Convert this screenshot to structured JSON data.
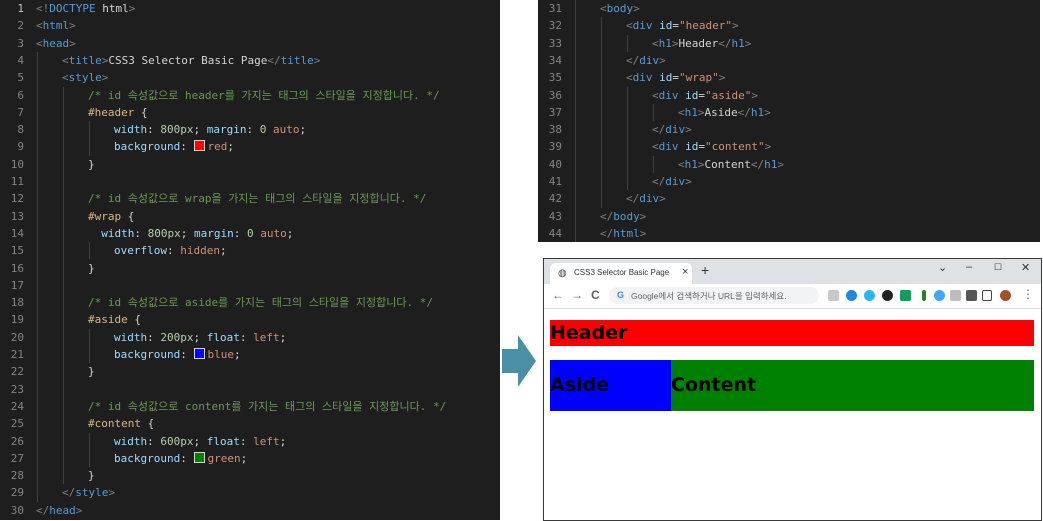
{
  "left_editor": {
    "lines": [
      {
        "n": "1",
        "indent": 0,
        "tokens": [
          [
            "punc",
            "<!"
          ],
          [
            "tag",
            "DOCTYPE"
          ],
          [
            "text",
            " html"
          ],
          [
            "punc",
            ">"
          ]
        ]
      },
      {
        "n": "2",
        "indent": 0,
        "tokens": [
          [
            "punc",
            "<"
          ],
          [
            "tag",
            "html"
          ],
          [
            "punc",
            ">"
          ]
        ]
      },
      {
        "n": "3",
        "indent": 0,
        "tokens": [
          [
            "punc",
            "<"
          ],
          [
            "tag",
            "head"
          ],
          [
            "punc",
            ">"
          ]
        ]
      },
      {
        "n": "4",
        "indent": 1,
        "tokens": [
          [
            "punc",
            "<"
          ],
          [
            "tag",
            "title"
          ],
          [
            "punc",
            ">"
          ],
          [
            "text",
            "CSS3 Selector Basic Page"
          ],
          [
            "punc",
            "</"
          ],
          [
            "tag",
            "title"
          ],
          [
            "punc",
            ">"
          ]
        ]
      },
      {
        "n": "5",
        "indent": 1,
        "tokens": [
          [
            "punc",
            "<"
          ],
          [
            "tag",
            "style"
          ],
          [
            "punc",
            ">"
          ]
        ]
      },
      {
        "n": "6",
        "indent": 2,
        "tokens": [
          [
            "comment",
            "/* id 속성값으로 header를 가지는 태그의 스타일을 지정합니다. */"
          ]
        ]
      },
      {
        "n": "7",
        "indent": 2,
        "tokens": [
          [
            "sel",
            "#header"
          ],
          [
            "text",
            " {"
          ]
        ]
      },
      {
        "n": "8",
        "indent": 3,
        "tokens": [
          [
            "prop",
            "width"
          ],
          [
            "text",
            ": "
          ],
          [
            "num",
            "800px"
          ],
          [
            "text",
            "; "
          ],
          [
            "prop",
            "margin"
          ],
          [
            "text",
            ": "
          ],
          [
            "num",
            "0"
          ],
          [
            "text",
            " "
          ],
          [
            "val",
            "auto"
          ],
          [
            "text",
            ";"
          ]
        ]
      },
      {
        "n": "9",
        "indent": 3,
        "tokens": [
          [
            "prop",
            "background"
          ],
          [
            "text",
            ": "
          ],
          [
            "swatch",
            "#ff0000"
          ],
          [
            "val",
            "red"
          ],
          [
            "text",
            ";"
          ]
        ]
      },
      {
        "n": "10",
        "indent": 2,
        "tokens": [
          [
            "text",
            "}"
          ]
        ]
      },
      {
        "n": "11",
        "indent": 0,
        "tokens": []
      },
      {
        "n": "12",
        "indent": 2,
        "tokens": [
          [
            "comment",
            "/* id 속성값으로 wrap을 가지는 태그의 스타일을 지정합니다. */"
          ]
        ]
      },
      {
        "n": "13",
        "indent": 2,
        "tokens": [
          [
            "sel",
            "#wrap"
          ],
          [
            "text",
            " {"
          ]
        ]
      },
      {
        "n": "14",
        "indent": 2,
        "tokens": [
          [
            "text",
            "  "
          ],
          [
            "prop",
            "width"
          ],
          [
            "text",
            ": "
          ],
          [
            "num",
            "800px"
          ],
          [
            "text",
            "; "
          ],
          [
            "prop",
            "margin"
          ],
          [
            "text",
            ": "
          ],
          [
            "num",
            "0"
          ],
          [
            "text",
            " "
          ],
          [
            "val",
            "auto"
          ],
          [
            "text",
            ";"
          ]
        ]
      },
      {
        "n": "15",
        "indent": 3,
        "tokens": [
          [
            "prop",
            "overflow"
          ],
          [
            "text",
            ": "
          ],
          [
            "val",
            "hidden"
          ],
          [
            "text",
            ";"
          ]
        ]
      },
      {
        "n": "16",
        "indent": 2,
        "tokens": [
          [
            "text",
            "}"
          ]
        ]
      },
      {
        "n": "17",
        "indent": 0,
        "tokens": []
      },
      {
        "n": "18",
        "indent": 2,
        "tokens": [
          [
            "comment",
            "/* id 속성값으로 aside를 가지는 태그의 스타일을 지정합니다. */"
          ]
        ]
      },
      {
        "n": "19",
        "indent": 2,
        "tokens": [
          [
            "sel",
            "#aside"
          ],
          [
            "text",
            " {"
          ]
        ]
      },
      {
        "n": "20",
        "indent": 3,
        "tokens": [
          [
            "prop",
            "width"
          ],
          [
            "text",
            ": "
          ],
          [
            "num",
            "200px"
          ],
          [
            "text",
            "; "
          ],
          [
            "prop",
            "float"
          ],
          [
            "text",
            ": "
          ],
          [
            "val",
            "left"
          ],
          [
            "text",
            ";"
          ]
        ]
      },
      {
        "n": "21",
        "indent": 3,
        "tokens": [
          [
            "prop",
            "background"
          ],
          [
            "text",
            ": "
          ],
          [
            "swatch",
            "#0000ff"
          ],
          [
            "val",
            "blue"
          ],
          [
            "text",
            ";"
          ]
        ]
      },
      {
        "n": "22",
        "indent": 2,
        "tokens": [
          [
            "text",
            "}"
          ]
        ]
      },
      {
        "n": "23",
        "indent": 0,
        "tokens": []
      },
      {
        "n": "24",
        "indent": 2,
        "tokens": [
          [
            "comment",
            "/* id 속성값으로 content를 가지는 태그의 스타일을 지정합니다. */"
          ]
        ]
      },
      {
        "n": "25",
        "indent": 2,
        "tokens": [
          [
            "sel",
            "#content"
          ],
          [
            "text",
            " {"
          ]
        ]
      },
      {
        "n": "26",
        "indent": 3,
        "tokens": [
          [
            "prop",
            "width"
          ],
          [
            "text",
            ": "
          ],
          [
            "num",
            "600px"
          ],
          [
            "text",
            "; "
          ],
          [
            "prop",
            "float"
          ],
          [
            "text",
            ": "
          ],
          [
            "val",
            "left"
          ],
          [
            "text",
            ";"
          ]
        ]
      },
      {
        "n": "27",
        "indent": 3,
        "tokens": [
          [
            "prop",
            "background"
          ],
          [
            "text",
            ": "
          ],
          [
            "swatch",
            "#008000"
          ],
          [
            "val",
            "green"
          ],
          [
            "text",
            ";"
          ]
        ]
      },
      {
        "n": "28",
        "indent": 2,
        "tokens": [
          [
            "text",
            "}"
          ]
        ]
      },
      {
        "n": "29",
        "indent": 1,
        "tokens": [
          [
            "punc",
            "</"
          ],
          [
            "tag",
            "style"
          ],
          [
            "punc",
            ">"
          ]
        ]
      },
      {
        "n": "30",
        "indent": 0,
        "tokens": [
          [
            "punc",
            "</"
          ],
          [
            "tag",
            "head"
          ],
          [
            "punc",
            ">"
          ]
        ]
      }
    ]
  },
  "right_editor": {
    "lines": [
      {
        "n": "31",
        "indent": 1,
        "tokens": [
          [
            "punc",
            "<"
          ],
          [
            "tag",
            "body"
          ],
          [
            "punc",
            ">"
          ]
        ]
      },
      {
        "n": "32",
        "indent": 2,
        "tokens": [
          [
            "punc",
            "<"
          ],
          [
            "tag",
            "div"
          ],
          [
            "text",
            " "
          ],
          [
            "attr",
            "id"
          ],
          [
            "text",
            "="
          ],
          [
            "str",
            "\"header\""
          ],
          [
            "punc",
            ">"
          ]
        ]
      },
      {
        "n": "33",
        "indent": 3,
        "tokens": [
          [
            "punc",
            "<"
          ],
          [
            "tag",
            "h1"
          ],
          [
            "punc",
            ">"
          ],
          [
            "text",
            "Header"
          ],
          [
            "punc",
            "</"
          ],
          [
            "tag",
            "h1"
          ],
          [
            "punc",
            ">"
          ]
        ]
      },
      {
        "n": "34",
        "indent": 2,
        "tokens": [
          [
            "punc",
            "</"
          ],
          [
            "tag",
            "div"
          ],
          [
            "punc",
            ">"
          ]
        ]
      },
      {
        "n": "35",
        "indent": 2,
        "tokens": [
          [
            "punc",
            "<"
          ],
          [
            "tag",
            "div"
          ],
          [
            "text",
            " "
          ],
          [
            "attr",
            "id"
          ],
          [
            "text",
            "="
          ],
          [
            "str",
            "\"wrap\""
          ],
          [
            "punc",
            ">"
          ]
        ]
      },
      {
        "n": "36",
        "indent": 3,
        "tokens": [
          [
            "punc",
            "<"
          ],
          [
            "tag",
            "div"
          ],
          [
            "text",
            " "
          ],
          [
            "attr",
            "id"
          ],
          [
            "text",
            "="
          ],
          [
            "str",
            "\"aside\""
          ],
          [
            "punc",
            ">"
          ]
        ]
      },
      {
        "n": "37",
        "indent": 4,
        "tokens": [
          [
            "punc",
            "<"
          ],
          [
            "tag",
            "h1"
          ],
          [
            "punc",
            ">"
          ],
          [
            "text",
            "Aside"
          ],
          [
            "punc",
            "</"
          ],
          [
            "tag",
            "h1"
          ],
          [
            "punc",
            ">"
          ]
        ]
      },
      {
        "n": "38",
        "indent": 3,
        "tokens": [
          [
            "punc",
            "</"
          ],
          [
            "tag",
            "div"
          ],
          [
            "punc",
            ">"
          ]
        ]
      },
      {
        "n": "39",
        "indent": 3,
        "tokens": [
          [
            "punc",
            "<"
          ],
          [
            "tag",
            "div"
          ],
          [
            "text",
            " "
          ],
          [
            "attr",
            "id"
          ],
          [
            "text",
            "="
          ],
          [
            "str",
            "\"content\""
          ],
          [
            "punc",
            ">"
          ]
        ]
      },
      {
        "n": "40",
        "indent": 4,
        "tokens": [
          [
            "punc",
            "<"
          ],
          [
            "tag",
            "h1"
          ],
          [
            "punc",
            ">"
          ],
          [
            "text",
            "Content"
          ],
          [
            "punc",
            "</"
          ],
          [
            "tag",
            "h1"
          ],
          [
            "punc",
            ">"
          ]
        ]
      },
      {
        "n": "41",
        "indent": 3,
        "tokens": [
          [
            "punc",
            "</"
          ],
          [
            "tag",
            "div"
          ],
          [
            "punc",
            ">"
          ]
        ]
      },
      {
        "n": "42",
        "indent": 2,
        "tokens": [
          [
            "punc",
            "</"
          ],
          [
            "tag",
            "div"
          ],
          [
            "punc",
            ">"
          ]
        ]
      },
      {
        "n": "43",
        "indent": 1,
        "tokens": [
          [
            "punc",
            "</"
          ],
          [
            "tag",
            "body"
          ],
          [
            "punc",
            ">"
          ]
        ]
      },
      {
        "n": "44",
        "indent": 1,
        "tokens": [
          [
            "punc",
            "</"
          ],
          [
            "tag",
            "html"
          ],
          [
            "punc",
            ">"
          ]
        ]
      }
    ]
  },
  "browser": {
    "tab_title": "CSS3 Selector Basic Page",
    "tab_close": "×",
    "new_tab": "+",
    "globe_icon": "globe-icon",
    "window_buttons": {
      "dropdown": "⌄",
      "minimize": "–",
      "maximize": "☐",
      "close": "✕"
    },
    "nav": {
      "back": "←",
      "forward": "→",
      "reload": "C"
    },
    "omnibox_g": "G",
    "omnibox_placeholder": "Google에서 검색하거나 URL을 입력하세요.",
    "more_icon": "⋮",
    "page": {
      "header": "Header",
      "aside": "Aside",
      "content": "Content"
    },
    "colors": {
      "header": "#ff0000",
      "aside": "#0000ff",
      "content": "#008000"
    }
  },
  "arrow_color": "#4a8fa3"
}
